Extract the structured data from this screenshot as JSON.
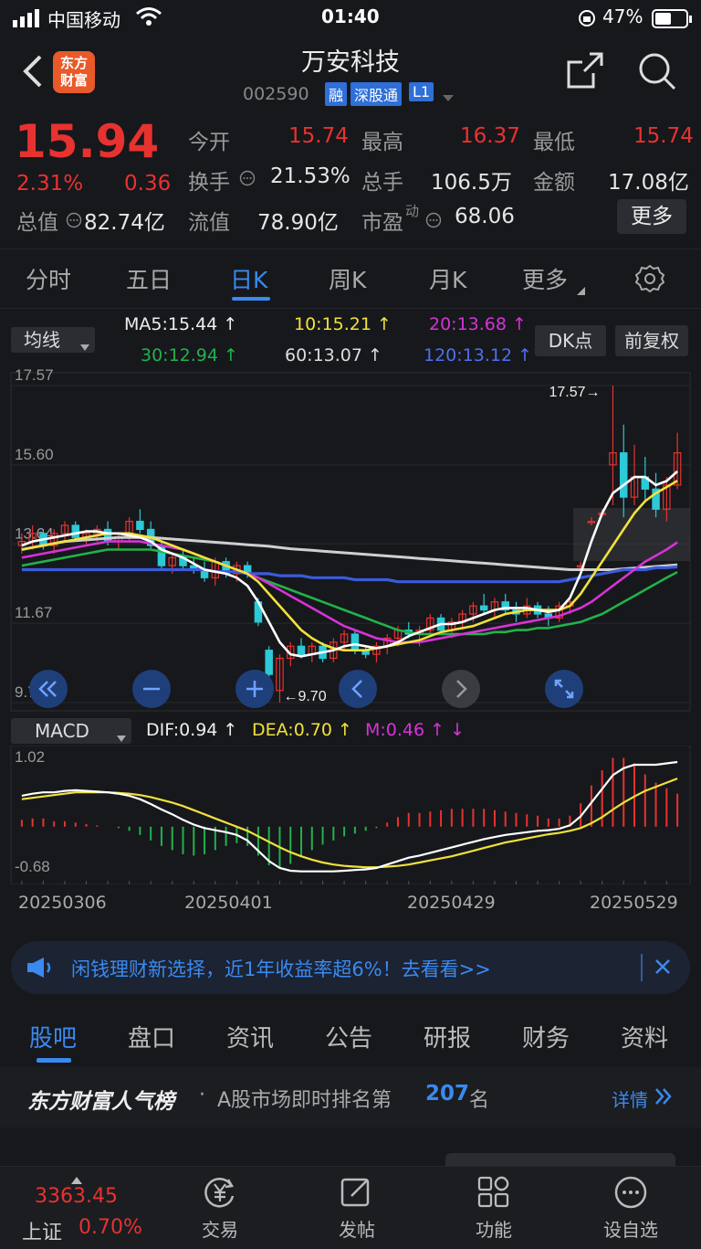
{
  "status": {
    "carrier": "中国移动",
    "time": "01:40",
    "battery": "47%"
  },
  "header": {
    "title": "万安科技",
    "code": "002590",
    "badges": [
      "融",
      "深股通",
      "L1"
    ],
    "logo_line1": "东方",
    "logo_line2": "财富"
  },
  "quote": {
    "price": "15.94",
    "pct": "2.31%",
    "chg": "0.36",
    "total_value_label": "总值",
    "total_value": "82.74亿",
    "open_label": "今开",
    "open": "15.74",
    "high_label": "最高",
    "high": "16.37",
    "low_label": "最低",
    "low": "15.74",
    "turnover_label": "换手",
    "turnover": "21.53%",
    "volume_label": "总手",
    "volume": "106.5万",
    "amount_label": "金额",
    "amount": "17.08亿",
    "float_label": "流值",
    "float_value": "78.90亿",
    "pe_label": "市盈",
    "pe_sup": "动",
    "pe": "68.06",
    "more_label": "更多"
  },
  "ktabs": [
    "分时",
    "五日",
    "日K",
    "周K",
    "月K",
    "更多"
  ],
  "ma": {
    "selector": "均线",
    "ma5": "MA5:15.44",
    "ma10": "10:15.21",
    "ma20": "20:13.68",
    "ma30": "30:12.94",
    "ma60": "60:13.07",
    "ma120": "120:13.12",
    "dk_btn": "DK点",
    "fq_btn": "前复权"
  },
  "chart_data": {
    "type": "candlestick",
    "y_ticks": [
      "17.57",
      "15.60",
      "13.64",
      "11.67",
      "9.70"
    ],
    "ylim": [
      9.7,
      17.57
    ],
    "annotations": {
      "high": "17.57",
      "low": "9.70"
    },
    "x_labels": [
      "20250306",
      "20250401",
      "20250429",
      "20250529"
    ],
    "candles": [
      [
        13.6,
        13.9,
        13.4,
        13.7
      ],
      [
        13.7,
        14.1,
        13.5,
        13.9
      ],
      [
        13.9,
        14.0,
        13.5,
        13.6
      ],
      [
        13.6,
        14.0,
        13.4,
        13.9
      ],
      [
        13.9,
        14.2,
        13.7,
        14.1
      ],
      [
        14.1,
        14.2,
        13.7,
        13.8
      ],
      [
        13.8,
        14.0,
        13.6,
        13.9
      ],
      [
        13.9,
        14.1,
        13.7,
        14.0
      ],
      [
        14.0,
        14.2,
        13.6,
        13.7
      ],
      [
        13.7,
        13.9,
        13.5,
        13.8
      ],
      [
        13.8,
        14.3,
        13.7,
        14.2
      ],
      [
        14.2,
        14.5,
        13.9,
        14.0
      ],
      [
        14.0,
        14.2,
        13.5,
        13.6
      ],
      [
        13.6,
        13.7,
        13.0,
        13.1
      ],
      [
        13.1,
        13.4,
        12.9,
        13.3
      ],
      [
        13.3,
        13.5,
        13.0,
        13.1
      ],
      [
        13.1,
        13.3,
        12.9,
        13.0
      ],
      [
        13.0,
        13.2,
        12.7,
        12.8
      ],
      [
        12.8,
        13.3,
        12.6,
        13.2
      ],
      [
        13.2,
        13.3,
        12.8,
        12.9
      ],
      [
        12.9,
        13.2,
        12.7,
        13.1
      ],
      [
        13.1,
        13.2,
        12.8,
        12.9
      ],
      [
        12.2,
        12.3,
        11.6,
        11.7
      ],
      [
        11.0,
        11.1,
        10.3,
        10.4
      ],
      [
        10.0,
        10.9,
        9.7,
        10.8
      ],
      [
        10.8,
        11.2,
        10.6,
        11.1
      ],
      [
        11.1,
        11.3,
        10.8,
        10.9
      ],
      [
        10.9,
        11.2,
        10.7,
        11.1
      ],
      [
        11.1,
        11.2,
        10.7,
        10.8
      ],
      [
        10.8,
        11.3,
        10.7,
        11.2
      ],
      [
        11.2,
        11.5,
        11.0,
        11.4
      ],
      [
        11.4,
        11.5,
        10.9,
        11.0
      ],
      [
        11.0,
        11.1,
        10.8,
        10.9
      ],
      [
        10.9,
        11.2,
        10.7,
        11.1
      ],
      [
        11.1,
        11.4,
        10.9,
        11.3
      ],
      [
        11.3,
        11.6,
        11.1,
        11.5
      ],
      [
        11.5,
        11.7,
        11.3,
        11.4
      ],
      [
        11.4,
        11.6,
        11.1,
        11.5
      ],
      [
        11.5,
        11.9,
        11.4,
        11.8
      ],
      [
        11.8,
        11.9,
        11.4,
        11.5
      ],
      [
        11.5,
        11.8,
        11.3,
        11.7
      ],
      [
        11.7,
        12.0,
        11.5,
        11.9
      ],
      [
        11.9,
        12.2,
        11.7,
        12.1
      ],
      [
        12.1,
        12.4,
        11.9,
        12.0
      ],
      [
        12.0,
        12.3,
        11.8,
        12.2
      ],
      [
        12.2,
        12.4,
        11.9,
        12.0
      ],
      [
        12.0,
        12.2,
        11.7,
        11.9
      ],
      [
        11.9,
        12.3,
        11.8,
        12.1
      ],
      [
        12.1,
        12.2,
        11.8,
        11.9
      ],
      [
        11.9,
        12.1,
        11.6,
        11.8
      ],
      [
        11.8,
        12.2,
        11.7,
        12.1
      ],
      [
        12.1,
        12.3,
        11.9,
        12.2
      ],
      [
        13.1,
        13.2,
        13.0,
        13.1
      ],
      [
        14.2,
        14.3,
        14.1,
        14.2
      ],
      [
        14.4,
        14.5,
        14.3,
        14.4
      ],
      [
        15.6,
        17.57,
        14.6,
        15.9
      ],
      [
        15.9,
        16.6,
        14.3,
        14.8
      ],
      [
        14.8,
        16.1,
        14.6,
        15.3
      ],
      [
        15.3,
        15.8,
        14.7,
        15.0
      ],
      [
        15.0,
        15.4,
        14.3,
        14.5
      ],
      [
        14.5,
        15.3,
        14.2,
        15.1
      ],
      [
        15.1,
        16.4,
        15.0,
        15.9
      ]
    ],
    "ma5": [
      13.6,
      13.7,
      13.75,
      13.8,
      13.85,
      13.9,
      13.95,
      13.95,
      13.9,
      13.9,
      13.85,
      13.8,
      13.7,
      13.5,
      13.4,
      13.3,
      13.15,
      13.0,
      12.95,
      12.9,
      12.8,
      12.6,
      12.2,
      11.7,
      11.2,
      10.9,
      10.85,
      10.9,
      10.95,
      11.0,
      11.1,
      11.15,
      11.1,
      11.05,
      11.1,
      11.2,
      11.35,
      11.45,
      11.55,
      11.65,
      11.65,
      11.7,
      11.8,
      11.9,
      12.0,
      12.05,
      12.05,
      12.05,
      12.0,
      11.95,
      12.0,
      12.3,
      12.9,
      13.7,
      14.4,
      14.9,
      15.1,
      15.3,
      15.3,
      15.1,
      15.2,
      15.44
    ],
    "ma10": [
      13.5,
      13.55,
      13.6,
      13.65,
      13.7,
      13.75,
      13.8,
      13.85,
      13.9,
      13.9,
      13.9,
      13.85,
      13.8,
      13.7,
      13.6,
      13.5,
      13.4,
      13.3,
      13.2,
      13.1,
      13.0,
      12.9,
      12.7,
      12.4,
      12.1,
      11.8,
      11.5,
      11.3,
      11.15,
      11.05,
      11.0,
      11.0,
      11.0,
      11.05,
      11.1,
      11.15,
      11.2,
      11.25,
      11.35,
      11.45,
      11.5,
      11.55,
      11.6,
      11.7,
      11.8,
      11.9,
      11.95,
      12.0,
      12.0,
      12.0,
      12.0,
      12.1,
      12.4,
      12.8,
      13.2,
      13.6,
      14.0,
      14.4,
      14.7,
      14.9,
      15.05,
      15.21
    ],
    "ma20": [
      13.3,
      13.35,
      13.4,
      13.45,
      13.5,
      13.55,
      13.6,
      13.65,
      13.7,
      13.7,
      13.7,
      13.7,
      13.65,
      13.6,
      13.55,
      13.5,
      13.4,
      13.3,
      13.2,
      13.1,
      13.0,
      12.9,
      12.8,
      12.65,
      12.5,
      12.35,
      12.2,
      12.05,
      11.9,
      11.75,
      11.6,
      11.5,
      11.4,
      11.3,
      11.25,
      11.2,
      11.2,
      11.2,
      11.25,
      11.3,
      11.35,
      11.4,
      11.45,
      11.5,
      11.55,
      11.6,
      11.65,
      11.7,
      11.75,
      11.8,
      11.85,
      11.95,
      12.05,
      12.2,
      12.4,
      12.6,
      12.8,
      13.0,
      13.2,
      13.35,
      13.5,
      13.68
    ],
    "ma30": [
      13.1,
      13.15,
      13.2,
      13.25,
      13.3,
      13.35,
      13.4,
      13.45,
      13.5,
      13.5,
      13.5,
      13.5,
      13.5,
      13.45,
      13.4,
      13.35,
      13.3,
      13.25,
      13.2,
      13.1,
      13.0,
      12.9,
      12.8,
      12.7,
      12.6,
      12.5,
      12.4,
      12.3,
      12.2,
      12.1,
      12.0,
      11.9,
      11.8,
      11.7,
      11.6,
      11.5,
      11.45,
      11.4,
      11.4,
      11.4,
      11.4,
      11.4,
      11.4,
      11.4,
      11.45,
      11.45,
      11.5,
      11.5,
      11.55,
      11.55,
      11.6,
      11.65,
      11.7,
      11.8,
      11.9,
      12.05,
      12.2,
      12.35,
      12.5,
      12.65,
      12.8,
      12.94
    ],
    "ma60": [
      13.0,
      13.0,
      13.0,
      13.0,
      13.0,
      13.0,
      13.0,
      13.0,
      13.0,
      13.0,
      13.0,
      13.0,
      13.0,
      13.0,
      13.0,
      13.0,
      13.0,
      13.0,
      12.95,
      12.95,
      12.95,
      12.9,
      12.9,
      12.9,
      12.85,
      12.85,
      12.85,
      12.8,
      12.8,
      12.8,
      12.8,
      12.75,
      12.75,
      12.75,
      12.75,
      12.7,
      12.7,
      12.7,
      12.7,
      12.7,
      12.7,
      12.7,
      12.7,
      12.7,
      12.7,
      12.7,
      12.7,
      12.7,
      12.7,
      12.7,
      12.7,
      12.75,
      12.8,
      12.85,
      12.9,
      12.95,
      13.0,
      13.0,
      13.0,
      13.05,
      13.05,
      13.07
    ],
    "ma120": [
      13.5,
      13.55,
      13.6,
      13.65,
      13.7,
      13.72,
      13.74,
      13.76,
      13.78,
      13.8,
      13.8,
      13.8,
      13.8,
      13.78,
      13.76,
      13.74,
      13.72,
      13.7,
      13.68,
      13.66,
      13.64,
      13.62,
      13.6,
      13.58,
      13.55,
      13.52,
      13.5,
      13.48,
      13.46,
      13.44,
      13.42,
      13.4,
      13.38,
      13.36,
      13.34,
      13.32,
      13.3,
      13.28,
      13.26,
      13.24,
      13.22,
      13.2,
      13.18,
      13.16,
      13.14,
      13.12,
      13.1,
      13.08,
      13.06,
      13.04,
      13.02,
      13.0,
      13.0,
      13.0,
      13.0,
      13.0,
      13.02,
      13.04,
      13.06,
      13.08,
      13.1,
      13.12
    ],
    "macd": {
      "selector": "MACD",
      "dif_label": "DIF:0.94",
      "dea_label": "DEA:0.70",
      "m_label": "M:0.46",
      "y_ticks": [
        "1.02",
        "-0.68"
      ],
      "ylim": [
        -0.68,
        1.02
      ],
      "dif": [
        0.45,
        0.48,
        0.5,
        0.5,
        0.52,
        0.53,
        0.52,
        0.51,
        0.5,
        0.48,
        0.45,
        0.4,
        0.33,
        0.25,
        0.18,
        0.1,
        0.03,
        -0.02,
        -0.05,
        -0.08,
        -0.12,
        -0.2,
        -0.35,
        -0.5,
        -0.6,
        -0.64,
        -0.65,
        -0.65,
        -0.65,
        -0.65,
        -0.64,
        -0.63,
        -0.62,
        -0.6,
        -0.55,
        -0.5,
        -0.45,
        -0.42,
        -0.38,
        -0.34,
        -0.3,
        -0.26,
        -0.22,
        -0.18,
        -0.15,
        -0.12,
        -0.1,
        -0.08,
        -0.06,
        -0.05,
        -0.03,
        0.02,
        0.15,
        0.35,
        0.55,
        0.75,
        0.85,
        0.9,
        0.9,
        0.9,
        0.92,
        0.94
      ],
      "dea": [
        0.4,
        0.42,
        0.44,
        0.46,
        0.48,
        0.5,
        0.5,
        0.5,
        0.5,
        0.49,
        0.48,
        0.46,
        0.43,
        0.39,
        0.35,
        0.3,
        0.24,
        0.18,
        0.12,
        0.06,
        0.0,
        -0.06,
        -0.14,
        -0.22,
        -0.3,
        -0.37,
        -0.43,
        -0.48,
        -0.52,
        -0.55,
        -0.57,
        -0.58,
        -0.59,
        -0.59,
        -0.58,
        -0.57,
        -0.55,
        -0.52,
        -0.49,
        -0.46,
        -0.43,
        -0.39,
        -0.35,
        -0.31,
        -0.27,
        -0.23,
        -0.2,
        -0.17,
        -0.14,
        -0.11,
        -0.09,
        -0.06,
        -0.02,
        0.05,
        0.14,
        0.25,
        0.35,
        0.44,
        0.52,
        0.58,
        0.64,
        0.7
      ]
    }
  },
  "promo": {
    "text": "闲钱理财新选择，近1年收益率超6%！去看看>>"
  },
  "btabs": [
    "股吧",
    "盘口",
    "资讯",
    "公告",
    "研报",
    "财务",
    "资料"
  ],
  "rank": {
    "brand": "东方财富人气榜",
    "text": "A股市场即时排名第",
    "num": "207",
    "suffix": "名",
    "link": "详情"
  },
  "botnav": {
    "index_value": "3363.45",
    "index_name": "上证",
    "index_pct": "0.70%",
    "items": [
      "交易",
      "发帖",
      "功能",
      "设自选"
    ]
  }
}
